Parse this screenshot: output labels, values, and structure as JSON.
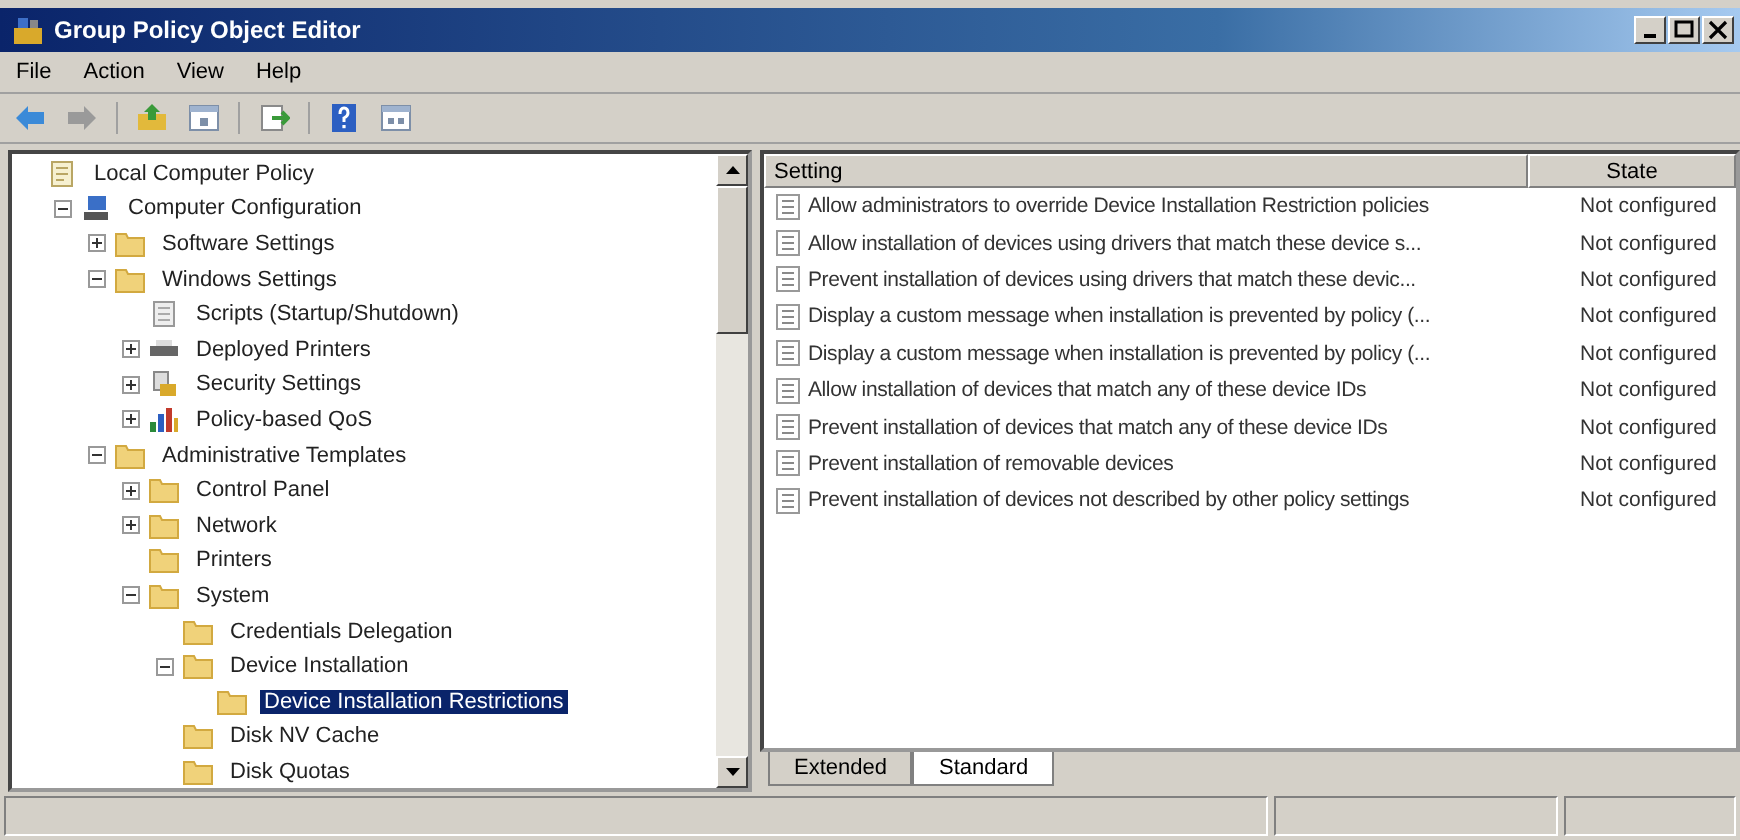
{
  "window": {
    "title": "Group Policy Object Editor"
  },
  "menu": [
    "File",
    "Action",
    "View",
    "Help"
  ],
  "tree": [
    {
      "label": "Local Computer Policy",
      "kind": "policy",
      "selected": false,
      "children": [
        {
          "label": "Computer Configuration",
          "kind": "computer",
          "expanded": true,
          "selected": false,
          "children": [
            {
              "label": "Software Settings",
              "kind": "folder",
              "expanded": false,
              "selected": false
            },
            {
              "label": "Windows Settings",
              "kind": "folder",
              "expanded": true,
              "selected": false,
              "children": [
                {
                  "label": "Scripts (Startup/Shutdown)",
                  "kind": "script",
                  "selected": false
                },
                {
                  "label": "Deployed Printers",
                  "kind": "printer",
                  "expanded": false,
                  "selected": false
                },
                {
                  "label": "Security Settings",
                  "kind": "security",
                  "expanded": false,
                  "selected": false
                },
                {
                  "label": "Policy-based QoS",
                  "kind": "qos",
                  "expanded": false,
                  "selected": false
                }
              ]
            },
            {
              "label": "Administrative Templates",
              "kind": "folder",
              "expanded": true,
              "selected": false,
              "children": [
                {
                  "label": "Control Panel",
                  "kind": "folder",
                  "expanded": false,
                  "selected": false
                },
                {
                  "label": "Network",
                  "kind": "folder",
                  "expanded": false,
                  "selected": false
                },
                {
                  "label": "Printers",
                  "kind": "folder",
                  "selected": false
                },
                {
                  "label": "System",
                  "kind": "folder",
                  "expanded": true,
                  "selected": false,
                  "children": [
                    {
                      "label": "Credentials Delegation",
                      "kind": "folder",
                      "selected": false
                    },
                    {
                      "label": "Device Installation",
                      "kind": "folder",
                      "expanded": true,
                      "selected": false,
                      "children": [
                        {
                          "label": "Device Installation Restrictions",
                          "kind": "folder",
                          "selected": true
                        }
                      ]
                    },
                    {
                      "label": "Disk NV Cache",
                      "kind": "folder",
                      "selected": false
                    },
                    {
                      "label": "Disk Quotas",
                      "kind": "folder",
                      "selected": false
                    }
                  ]
                }
              ]
            }
          ]
        }
      ]
    }
  ],
  "table": {
    "columns": [
      "Setting",
      "State"
    ],
    "rows": [
      {
        "setting": "Allow administrators to override Device Installation Restriction policies",
        "state": "Not configured"
      },
      {
        "setting": "Allow installation of devices using drivers that match these device s...",
        "state": "Not configured"
      },
      {
        "setting": "Prevent installation of devices using drivers that match these devic...",
        "state": "Not configured"
      },
      {
        "setting": "Display a custom message when installation is prevented by policy (...",
        "state": "Not configured"
      },
      {
        "setting": "Display a custom message when installation is prevented by policy (...",
        "state": "Not configured"
      },
      {
        "setting": "Allow installation of devices that match any of these device IDs",
        "state": "Not configured"
      },
      {
        "setting": "Prevent installation of devices that match any of these device IDs",
        "state": "Not configured"
      },
      {
        "setting": "Prevent installation of removable devices",
        "state": "Not configured"
      },
      {
        "setting": "Prevent installation of devices not described by other policy settings",
        "state": "Not configured"
      }
    ]
  },
  "tabs": [
    {
      "label": "Extended",
      "selected": false
    },
    {
      "label": "Standard",
      "selected": true
    }
  ]
}
